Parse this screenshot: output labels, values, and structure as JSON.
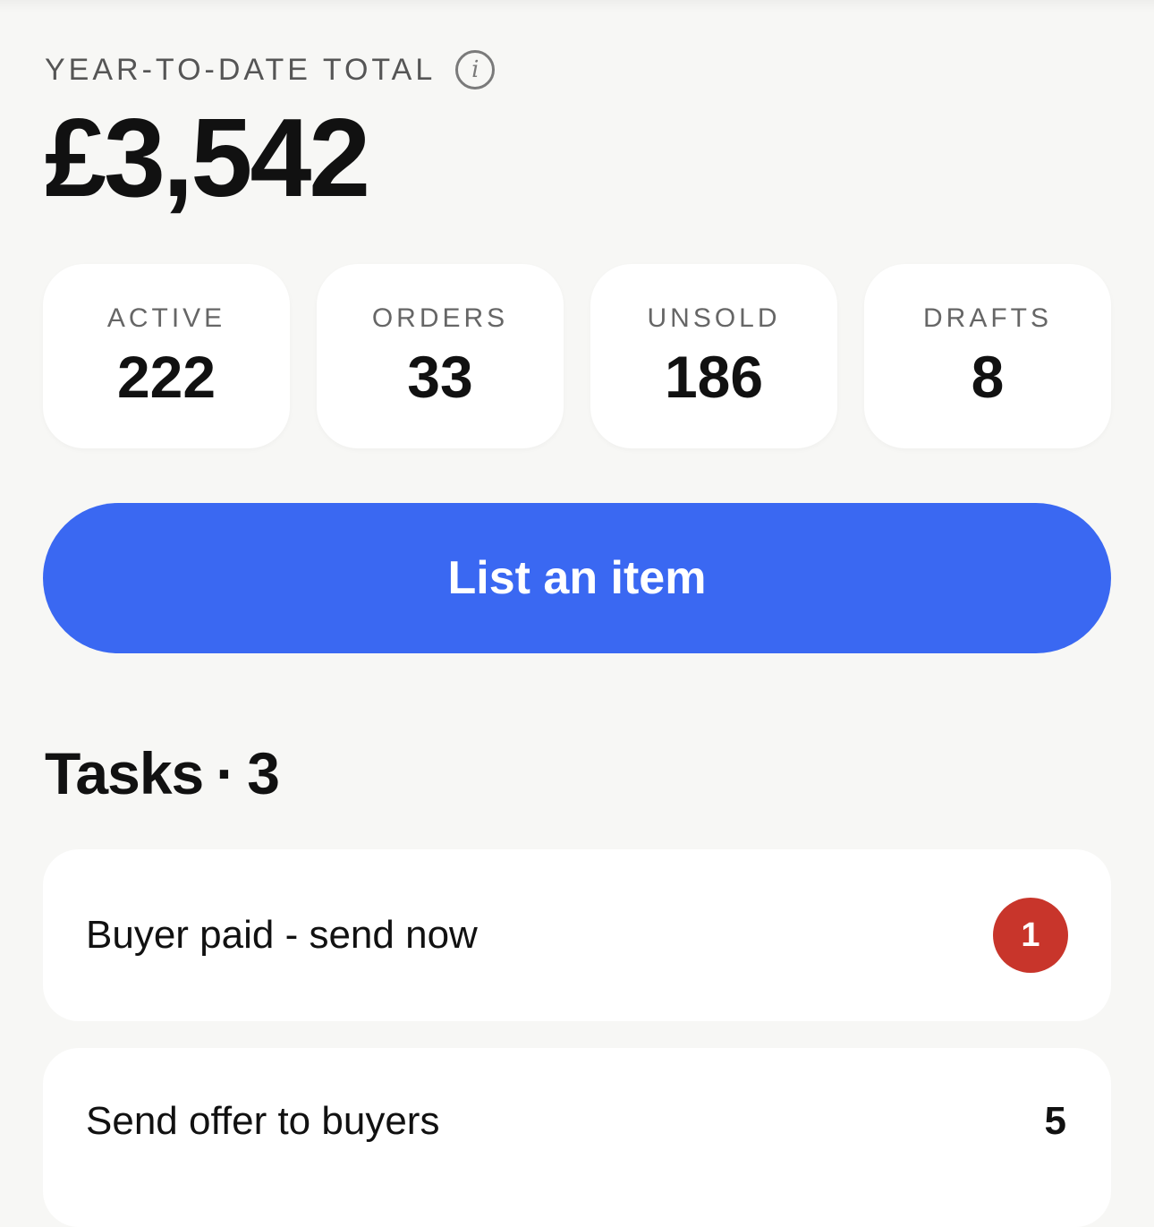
{
  "summary": {
    "ytd_label": "YEAR-TO-DATE TOTAL",
    "info_icon": "info-icon",
    "total": "£3,542"
  },
  "stats": [
    {
      "label": "ACTIVE",
      "value": "222"
    },
    {
      "label": "ORDERS",
      "value": "33"
    },
    {
      "label": "UNSOLD",
      "value": "186"
    },
    {
      "label": "DRAFTS",
      "value": "8"
    }
  ],
  "cta": {
    "label": "List an item",
    "color": "#3a68f2"
  },
  "tasks": {
    "title": "Tasks",
    "separator": "·",
    "count": "3",
    "items": [
      {
        "label": "Buyer paid - send now",
        "badge": "1",
        "badge_color": "#c8352b"
      },
      {
        "label": "Send offer to buyers",
        "count": "5"
      }
    ]
  }
}
